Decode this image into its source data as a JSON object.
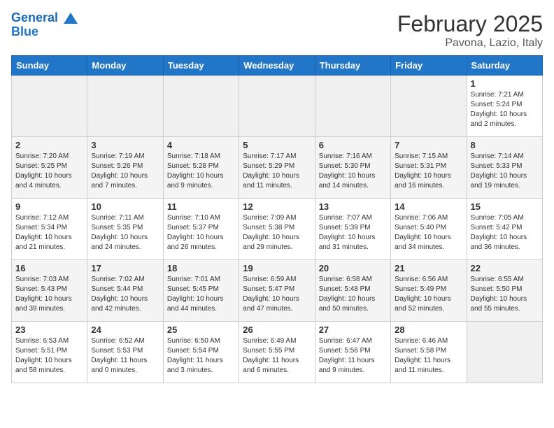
{
  "header": {
    "logo_line1": "General",
    "logo_line2": "Blue",
    "month": "February 2025",
    "location": "Pavona, Lazio, Italy"
  },
  "weekdays": [
    "Sunday",
    "Monday",
    "Tuesday",
    "Wednesday",
    "Thursday",
    "Friday",
    "Saturday"
  ],
  "weeks": [
    [
      {
        "day": "",
        "info": ""
      },
      {
        "day": "",
        "info": ""
      },
      {
        "day": "",
        "info": ""
      },
      {
        "day": "",
        "info": ""
      },
      {
        "day": "",
        "info": ""
      },
      {
        "day": "",
        "info": ""
      },
      {
        "day": "1",
        "info": "Sunrise: 7:21 AM\nSunset: 5:24 PM\nDaylight: 10 hours\nand 2 minutes."
      }
    ],
    [
      {
        "day": "2",
        "info": "Sunrise: 7:20 AM\nSunset: 5:25 PM\nDaylight: 10 hours\nand 4 minutes."
      },
      {
        "day": "3",
        "info": "Sunrise: 7:19 AM\nSunset: 5:26 PM\nDaylight: 10 hours\nand 7 minutes."
      },
      {
        "day": "4",
        "info": "Sunrise: 7:18 AM\nSunset: 5:28 PM\nDaylight: 10 hours\nand 9 minutes."
      },
      {
        "day": "5",
        "info": "Sunrise: 7:17 AM\nSunset: 5:29 PM\nDaylight: 10 hours\nand 11 minutes."
      },
      {
        "day": "6",
        "info": "Sunrise: 7:16 AM\nSunset: 5:30 PM\nDaylight: 10 hours\nand 14 minutes."
      },
      {
        "day": "7",
        "info": "Sunrise: 7:15 AM\nSunset: 5:31 PM\nDaylight: 10 hours\nand 16 minutes."
      },
      {
        "day": "8",
        "info": "Sunrise: 7:14 AM\nSunset: 5:33 PM\nDaylight: 10 hours\nand 19 minutes."
      }
    ],
    [
      {
        "day": "9",
        "info": "Sunrise: 7:12 AM\nSunset: 5:34 PM\nDaylight: 10 hours\nand 21 minutes."
      },
      {
        "day": "10",
        "info": "Sunrise: 7:11 AM\nSunset: 5:35 PM\nDaylight: 10 hours\nand 24 minutes."
      },
      {
        "day": "11",
        "info": "Sunrise: 7:10 AM\nSunset: 5:37 PM\nDaylight: 10 hours\nand 26 minutes."
      },
      {
        "day": "12",
        "info": "Sunrise: 7:09 AM\nSunset: 5:38 PM\nDaylight: 10 hours\nand 29 minutes."
      },
      {
        "day": "13",
        "info": "Sunrise: 7:07 AM\nSunset: 5:39 PM\nDaylight: 10 hours\nand 31 minutes."
      },
      {
        "day": "14",
        "info": "Sunrise: 7:06 AM\nSunset: 5:40 PM\nDaylight: 10 hours\nand 34 minutes."
      },
      {
        "day": "15",
        "info": "Sunrise: 7:05 AM\nSunset: 5:42 PM\nDaylight: 10 hours\nand 36 minutes."
      }
    ],
    [
      {
        "day": "16",
        "info": "Sunrise: 7:03 AM\nSunset: 5:43 PM\nDaylight: 10 hours\nand 39 minutes."
      },
      {
        "day": "17",
        "info": "Sunrise: 7:02 AM\nSunset: 5:44 PM\nDaylight: 10 hours\nand 42 minutes."
      },
      {
        "day": "18",
        "info": "Sunrise: 7:01 AM\nSunset: 5:45 PM\nDaylight: 10 hours\nand 44 minutes."
      },
      {
        "day": "19",
        "info": "Sunrise: 6:59 AM\nSunset: 5:47 PM\nDaylight: 10 hours\nand 47 minutes."
      },
      {
        "day": "20",
        "info": "Sunrise: 6:58 AM\nSunset: 5:48 PM\nDaylight: 10 hours\nand 50 minutes."
      },
      {
        "day": "21",
        "info": "Sunrise: 6:56 AM\nSunset: 5:49 PM\nDaylight: 10 hours\nand 52 minutes."
      },
      {
        "day": "22",
        "info": "Sunrise: 6:55 AM\nSunset: 5:50 PM\nDaylight: 10 hours\nand 55 minutes."
      }
    ],
    [
      {
        "day": "23",
        "info": "Sunrise: 6:53 AM\nSunset: 5:51 PM\nDaylight: 10 hours\nand 58 minutes."
      },
      {
        "day": "24",
        "info": "Sunrise: 6:52 AM\nSunset: 5:53 PM\nDaylight: 11 hours\nand 0 minutes."
      },
      {
        "day": "25",
        "info": "Sunrise: 6:50 AM\nSunset: 5:54 PM\nDaylight: 11 hours\nand 3 minutes."
      },
      {
        "day": "26",
        "info": "Sunrise: 6:49 AM\nSunset: 5:55 PM\nDaylight: 11 hours\nand 6 minutes."
      },
      {
        "day": "27",
        "info": "Sunrise: 6:47 AM\nSunset: 5:56 PM\nDaylight: 11 hours\nand 9 minutes."
      },
      {
        "day": "28",
        "info": "Sunrise: 6:46 AM\nSunset: 5:58 PM\nDaylight: 11 hours\nand 11 minutes."
      },
      {
        "day": "",
        "info": ""
      }
    ]
  ]
}
